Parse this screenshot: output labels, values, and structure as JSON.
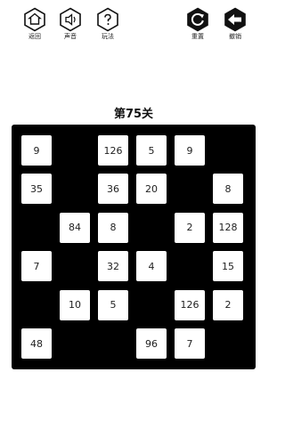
{
  "toolbar": {
    "back_label": "返回",
    "sound_label": "声音",
    "help_label": "玩法",
    "reset_label": "重置",
    "undo_label": "撤销"
  },
  "level": {
    "title": "第75关"
  },
  "board": {
    "rows": 6,
    "cols": 6,
    "cells": [
      [
        "9",
        "",
        "126",
        "5",
        "9",
        ""
      ],
      [
        "35",
        "",
        "36",
        "20",
        "",
        "8"
      ],
      [
        "",
        "84",
        "8",
        "",
        "2",
        "128"
      ],
      [
        "7",
        "",
        "32",
        "4",
        "",
        "15"
      ],
      [
        "",
        "10",
        "5",
        "",
        "126",
        "2"
      ],
      [
        "48",
        "",
        "",
        "96",
        "7",
        ""
      ]
    ]
  },
  "colors": {
    "board": "#000000",
    "tile": "#ffffff",
    "text": "#222222"
  }
}
